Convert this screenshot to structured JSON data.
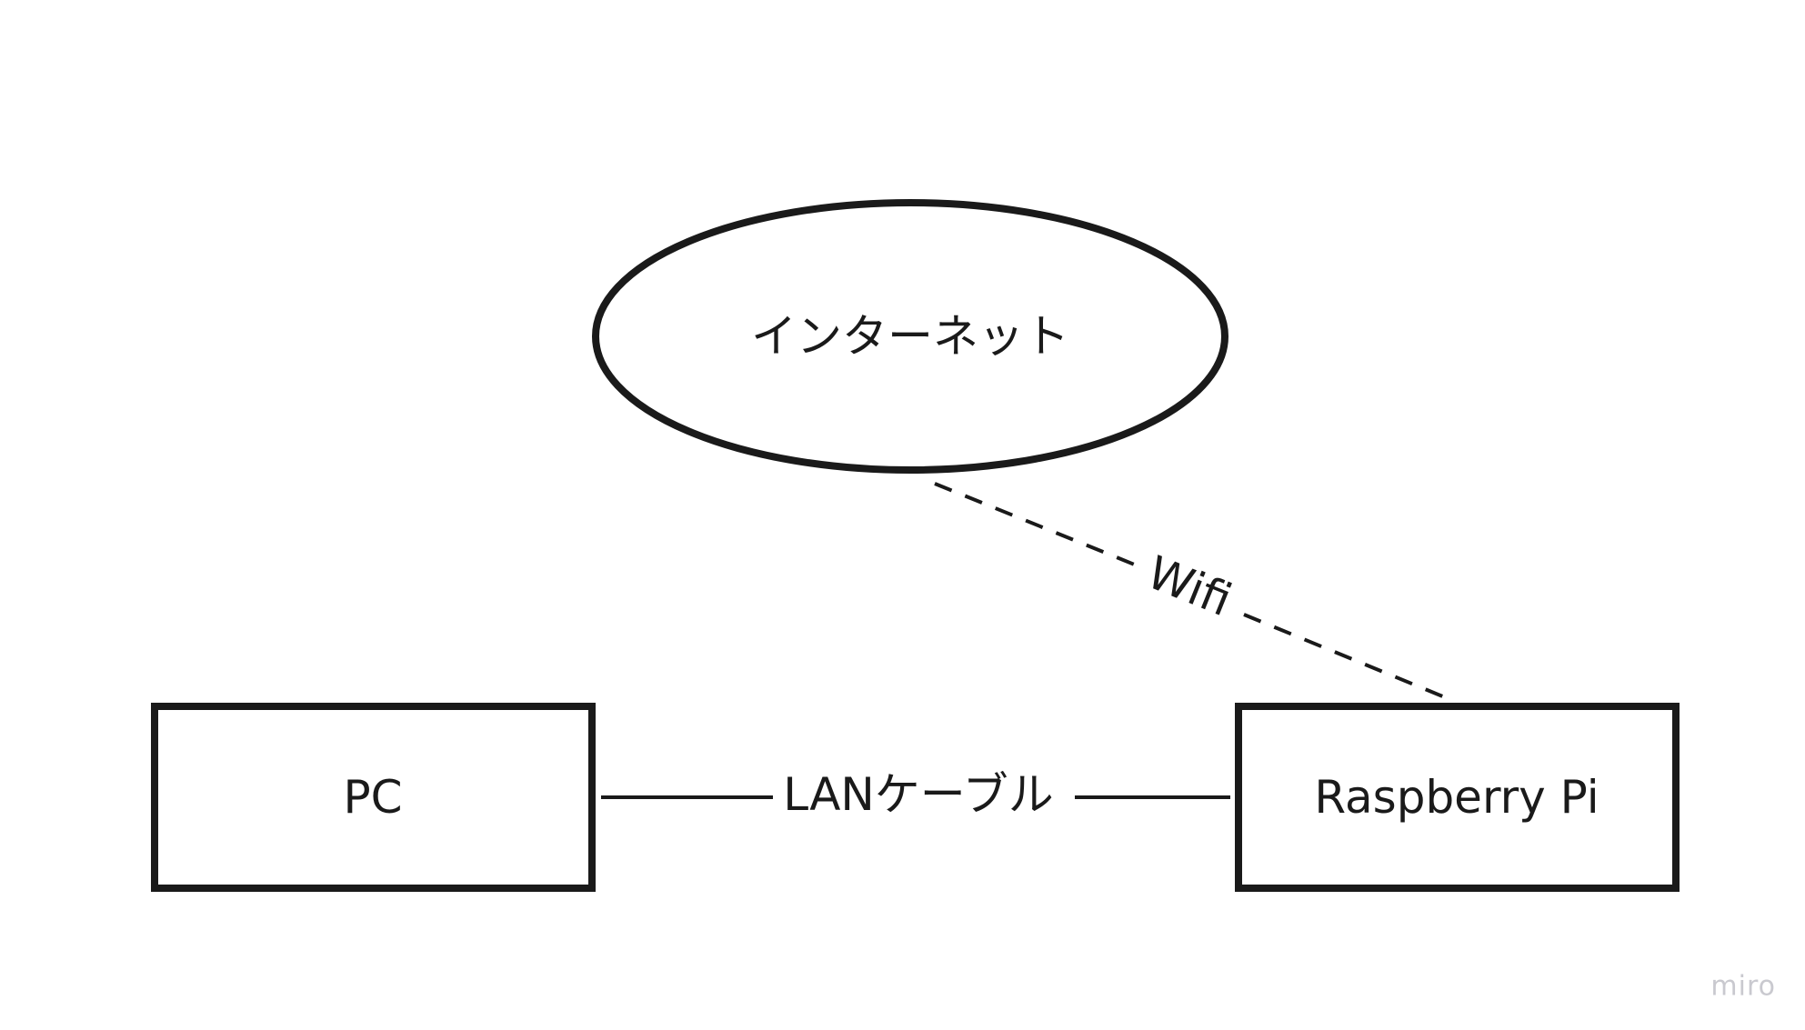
{
  "nodes": {
    "internet": {
      "label": "インターネット",
      "shape": "ellipse"
    },
    "pc": {
      "label": "PC",
      "shape": "rectangle"
    },
    "raspberry_pi": {
      "label": "Raspberry Pi",
      "shape": "rectangle"
    }
  },
  "edges": {
    "wifi": {
      "label": "Wifi",
      "from": "internet",
      "to": "raspberry_pi",
      "style": "dashed"
    },
    "lan": {
      "label": "LANケーブル",
      "from": "pc",
      "to": "raspberry_pi",
      "style": "solid"
    }
  },
  "watermark": "miro",
  "colors": {
    "stroke": "#1a1a1a",
    "background": "#ffffff",
    "watermark": "#c9c9cf"
  }
}
